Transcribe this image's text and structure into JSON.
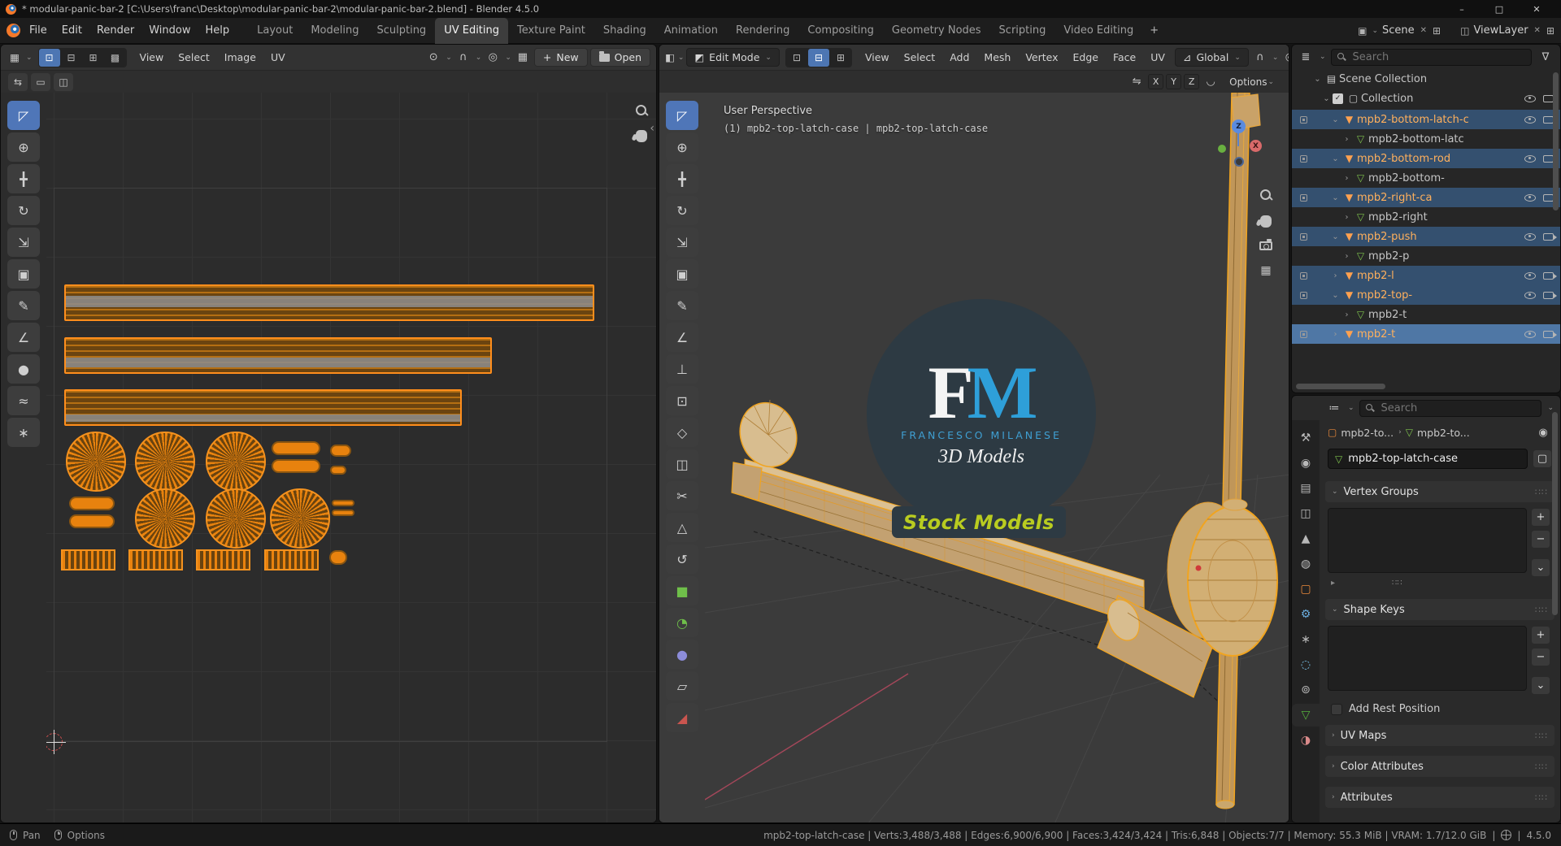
{
  "titlebar": {
    "title": "* modular-panic-bar-2 [C:\\Users\\franc\\Desktop\\modular-panic-bar-2\\modular-panic-bar-2.blend] - Blender 4.5.0"
  },
  "window_controls": {
    "minimize": "–",
    "maximize": "□",
    "close": "✕"
  },
  "icons": {
    "chevron_down": "⌄",
    "chevron_right": "›",
    "plus": "+",
    "remove": "−",
    "editor_uv_icon": "▦",
    "editor_3d_icon": "◧",
    "editor_outliner_icon": "≣",
    "editor_properties_icon": "≔",
    "pivot_icon": "⊙",
    "magnet_icon": "∩",
    "proportional_icon": "◎",
    "orientation_icon": "⊿",
    "edit_mode_icon": "◩",
    "image_icon": "▦",
    "mirror_icon": "⇋",
    "falloff_icon": "◡",
    "scene_icon": "▣",
    "viewlayer_icon": "◫",
    "clear_x": "✕",
    "pin_icon": "◉",
    "copy_icon": "⊞",
    "grip": "∷∷",
    "panel_arrow": "▸",
    "object_icon": "▢",
    "object_mesh_icon": "▼",
    "mesh_data_icon": "▽",
    "collection_icon": "▢",
    "scene_collection_icon": "▤",
    "filter_icon": "∇",
    "breadcrumb_sep": "›"
  },
  "topbar": {
    "menus": [
      "File",
      "Edit",
      "Render",
      "Window",
      "Help"
    ],
    "workspaces": [
      "Layout",
      "Modeling",
      "Sculpting",
      "UV Editing",
      "Texture Paint",
      "Shading",
      "Animation",
      "Rendering",
      "Compositing",
      "Geometry Nodes",
      "Scripting",
      "Video Editing"
    ],
    "active_workspace": "UV Editing",
    "add_workspace": "+",
    "scene": {
      "label": "Scene"
    },
    "viewlayer": {
      "label": "ViewLayer"
    }
  },
  "uv_editor": {
    "menus": [
      "View",
      "Select",
      "Image",
      "UV"
    ],
    "buttons": {
      "new": "New",
      "open": "Open"
    },
    "select_modes": [
      {
        "name": "vertex",
        "glyph": "⊡",
        "active": true
      },
      {
        "name": "edge",
        "glyph": "⊟"
      },
      {
        "name": "face",
        "glyph": "⊞"
      },
      {
        "name": "island",
        "glyph": "▩"
      }
    ],
    "subrow_icons": [
      {
        "name": "uv-sync-selection-toggle",
        "glyph": "⇆"
      },
      {
        "name": "uv-select-box-mode",
        "glyph": "▭"
      },
      {
        "name": "uv-snap-island-toggle",
        "glyph": "◫"
      }
    ],
    "tools": [
      {
        "name": "tweak-tool",
        "glyph": "◸",
        "active": true
      },
      {
        "name": "cursor-tool",
        "glyph": "⊕"
      },
      {
        "name": "move-tool",
        "glyph": "╋"
      },
      {
        "name": "rotate-tool",
        "glyph": "↻"
      },
      {
        "name": "scale-tool",
        "glyph": "⇲"
      },
      {
        "name": "transform-tool",
        "glyph": "▣"
      },
      {
        "name": "annotate-tool",
        "glyph": "✎"
      },
      {
        "name": "measure-tool",
        "glyph": "∠"
      },
      {
        "name": "grab-brush-tool",
        "glyph": "●"
      },
      {
        "name": "relax-brush-tool",
        "glyph": "≈"
      },
      {
        "name": "pinch-brush-tool",
        "glyph": "∗"
      }
    ]
  },
  "viewport3d": {
    "mode": "Edit Mode",
    "menus": [
      "View",
      "Select",
      "Add",
      "Mesh",
      "Vertex",
      "Edge",
      "Face",
      "UV"
    ],
    "orientation": "Global",
    "options": "Options",
    "axes": [
      "X",
      "Y",
      "Z"
    ],
    "select_modes": [
      {
        "name": "vertex",
        "glyph": "⊡"
      },
      {
        "name": "edge",
        "glyph": "⊟",
        "active": true
      },
      {
        "name": "face",
        "glyph": "⊞"
      }
    ],
    "overlay": {
      "perspective": "User Perspective",
      "active_object": "(1) mpb2-top-latch-case | mpb2-top-latch-case"
    },
    "gizmo": {
      "x": "X",
      "z": "Z"
    },
    "watermark": {
      "f": "F",
      "m": "M",
      "name": "FRANCESCO MILANESE",
      "subtitle": "3D Models",
      "banner": "Stock Models"
    },
    "tools": [
      {
        "name": "select-box-tool",
        "glyph": "◸",
        "active": true
      },
      {
        "name": "cursor-tool",
        "glyph": "⊕"
      },
      {
        "name": "move-tool",
        "glyph": "╋"
      },
      {
        "name": "rotate-tool",
        "glyph": "↻"
      },
      {
        "name": "scale-tool",
        "glyph": "⇲"
      },
      {
        "name": "transform-tool",
        "glyph": "▣"
      },
      {
        "name": "annotate-tool",
        "glyph": "✎"
      },
      {
        "name": "measure-tool",
        "glyph": "∠"
      },
      {
        "name": "extrude-region-tool",
        "glyph": "⊥"
      },
      {
        "name": "inset-faces-tool",
        "glyph": "⊡"
      },
      {
        "name": "bevel-tool",
        "glyph": "◇"
      },
      {
        "name": "loop-cut-tool",
        "glyph": "◫"
      },
      {
        "name": "knife-tool",
        "glyph": "✂"
      },
      {
        "name": "poly-build-tool",
        "glyph": "△"
      },
      {
        "name": "spin-tool",
        "glyph": "↺"
      },
      {
        "name": "add-cube-tool",
        "glyph": "■",
        "color": "#6fbf4a"
      },
      {
        "name": "add-cylinder-tool",
        "glyph": "◔",
        "color": "#6fbf4a"
      },
      {
        "name": "to-sphere-tool",
        "glyph": "●",
        "color": "#8c8cd9"
      },
      {
        "name": "shear-tool",
        "glyph": "▱"
      },
      {
        "name": "rip-region-tool",
        "glyph": "◢",
        "color": "#c9554f"
      }
    ]
  },
  "outliner": {
    "search_placeholder": "Search",
    "rows_header": {
      "scene_collection": "Scene Collection",
      "collection": "Collection"
    },
    "items": [
      {
        "label": "mpb2-bottom-latch-c",
        "kind": "object",
        "expanded": true,
        "selected": true
      },
      {
        "label": "mpb2-bottom-latc",
        "kind": "mesh-data",
        "expanded": false
      },
      {
        "label": "mpb2-bottom-rod",
        "kind": "object",
        "expanded": true,
        "selected": true
      },
      {
        "label": "mpb2-bottom-",
        "kind": "mesh-data",
        "expanded": false
      },
      {
        "label": "mpb2-right-ca",
        "kind": "object",
        "expanded": true,
        "selected": true
      },
      {
        "label": "mpb2-right",
        "kind": "mesh-data",
        "expanded": false
      },
      {
        "label": "mpb2-push",
        "kind": "object",
        "expanded": true,
        "selected": true
      },
      {
        "label": "mpb2-p",
        "kind": "mesh-data",
        "expanded": false
      },
      {
        "label": "mpb2-l",
        "kind": "object",
        "expanded": false,
        "selected": true
      },
      {
        "label": "mpb2-top-",
        "kind": "object",
        "expanded": true,
        "selected": true
      },
      {
        "label": "mpb2-t",
        "kind": "mesh-data",
        "expanded": false
      },
      {
        "label": "mpb2-t",
        "kind": "object",
        "expanded": false,
        "selected": true,
        "active": true
      }
    ]
  },
  "properties": {
    "search_placeholder": "Search",
    "breadcrumb": {
      "object": "mpb2-to...",
      "data": "mpb2-to..."
    },
    "mesh_name": "mpb2-top-latch-case",
    "sections": {
      "vertex_groups": "Vertex Groups",
      "shape_keys": "Shape Keys",
      "add_rest_position": "Add Rest Position",
      "uv_maps": "UV Maps",
      "color_attributes": "Color Attributes",
      "attributes": "Attributes"
    },
    "tabs": [
      {
        "name": "tool",
        "glyph": "⚒",
        "color": "#b8b8b8"
      },
      {
        "name": "render",
        "glyph": "◉",
        "color": "#b8b8b8"
      },
      {
        "name": "output",
        "glyph": "▤",
        "color": "#b8b8b8"
      },
      {
        "name": "view-layer",
        "glyph": "◫",
        "color": "#b8b8b8"
      },
      {
        "name": "scene",
        "glyph": "▲",
        "color": "#b8b8b8"
      },
      {
        "name": "world",
        "glyph": "◍",
        "color": "#b8b8b8"
      },
      {
        "name": "object",
        "glyph": "▢",
        "color": "#e8883a"
      },
      {
        "name": "modifiers",
        "glyph": "⚙",
        "color": "#6badde"
      },
      {
        "name": "particles",
        "glyph": "∗",
        "color": "#b8b8b8"
      },
      {
        "name": "physics",
        "glyph": "◌",
        "color": "#79c0e8"
      },
      {
        "name": "constraints",
        "glyph": "⊚",
        "color": "#b8b8b8"
      },
      {
        "name": "data",
        "glyph": "▽",
        "color": "#55b03c",
        "active": true
      },
      {
        "name": "material",
        "glyph": "◑",
        "color": "#d98a8a"
      }
    ]
  },
  "statusbar": {
    "pan": "Pan",
    "options": "Options",
    "stats": "mpb2-top-latch-case | Verts:3,488/3,488 | Edges:6,900/6,900 | Faces:3,424/3,424 | Tris:6,848 | Objects:7/7 | Memory: 55.3 MiB | VRAM: 1.7/12.0 GiB",
    "version": "4.5.0"
  }
}
